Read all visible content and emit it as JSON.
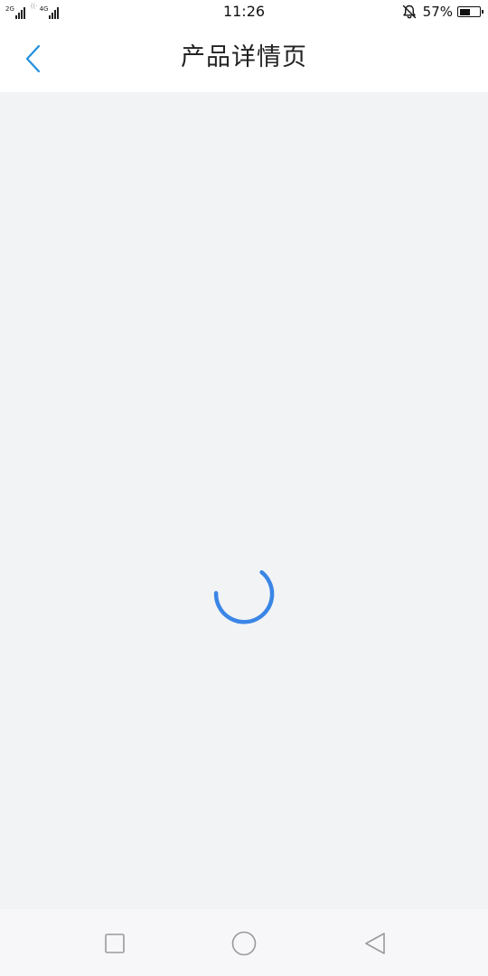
{
  "status_bar": {
    "sim1_label": "2G",
    "sim2_label": "4G",
    "time": "11:26",
    "battery_percent_text": "57%",
    "battery_level": 0.57,
    "icons": [
      "signal-icon",
      "wifi-calling-icon",
      "bell-muted-icon",
      "battery-icon"
    ]
  },
  "header": {
    "title": "产品详情页",
    "back_icon": "chevron-left-icon",
    "accent_color": "#1f8fe0"
  },
  "content": {
    "state": "loading",
    "spinner_color": "#3a86e6",
    "background_color": "#f2f3f5"
  },
  "nav_bar": {
    "icons": [
      "square-recents-icon",
      "circle-home-icon",
      "triangle-back-icon"
    ]
  }
}
